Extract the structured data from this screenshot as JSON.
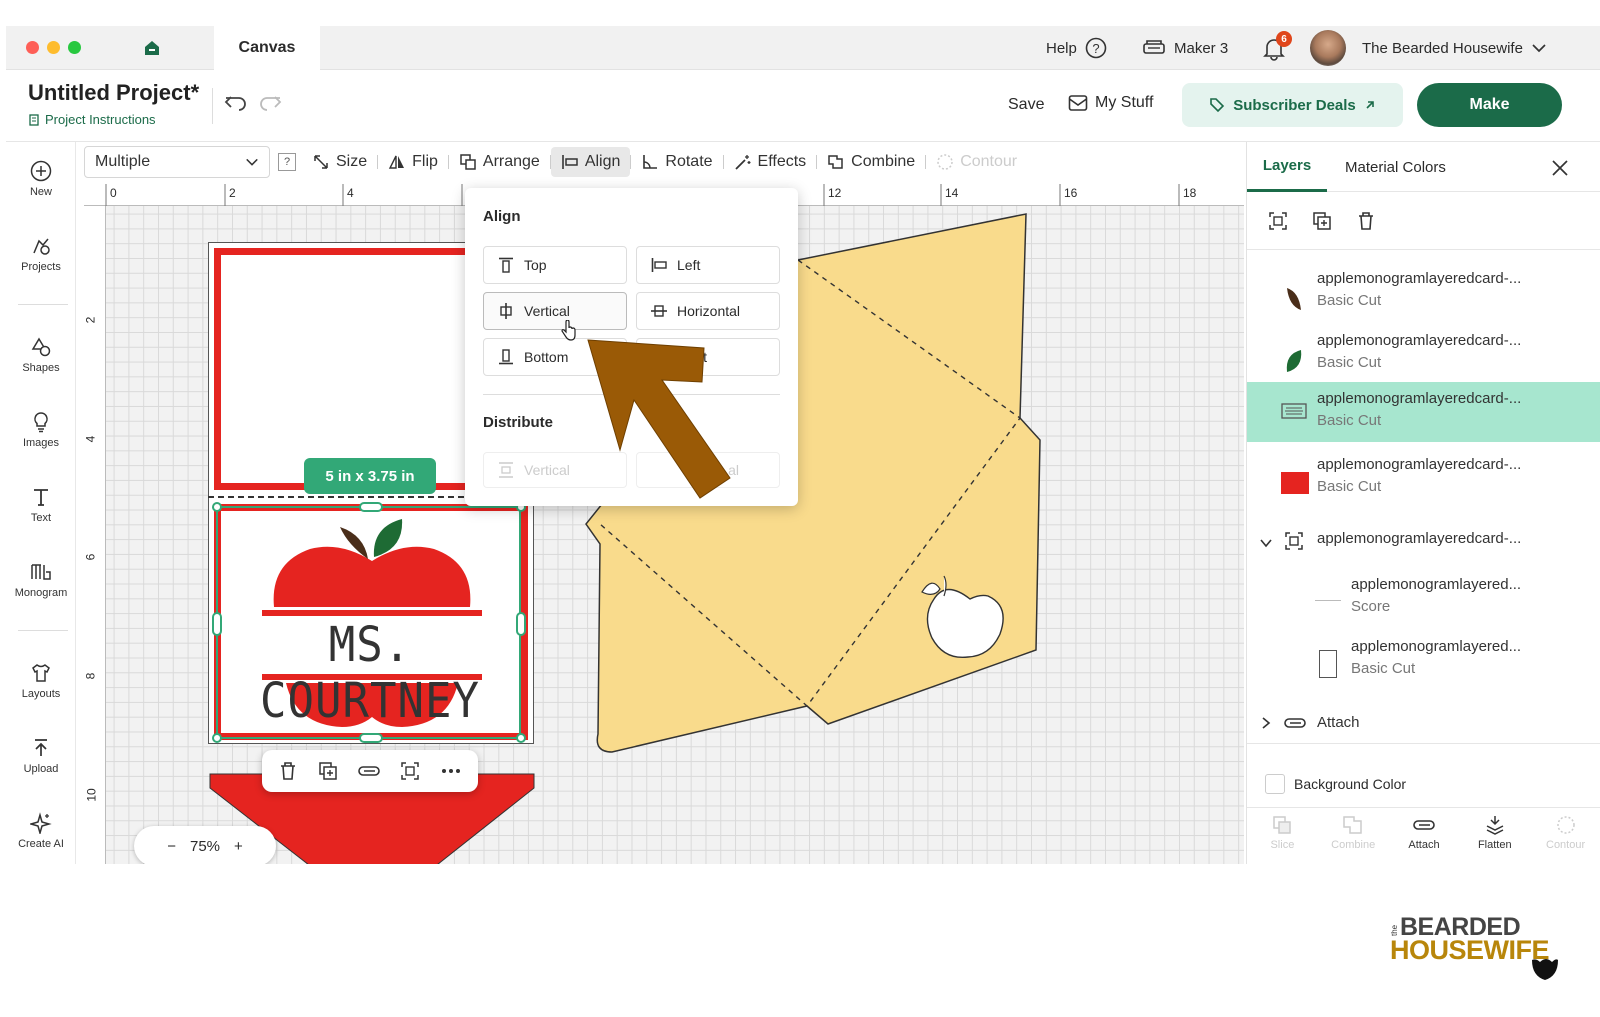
{
  "window": {
    "tab": "Canvas"
  },
  "topbar": {
    "help": "Help",
    "machine": "Maker 3",
    "notifications": "6",
    "user": "The Bearded Housewife"
  },
  "project": {
    "title": "Untitled Project*",
    "instructions": "Project Instructions",
    "save": "Save",
    "my_stuff": "My Stuff",
    "subscriber_deals": "Subscriber Deals",
    "make": "Make"
  },
  "toolbar": {
    "select": "Multiple",
    "help": "?",
    "size": "Size",
    "flip": "Flip",
    "arrange": "Arrange",
    "align": "Align",
    "rotate": "Rotate",
    "effects": "Effects",
    "combine": "Combine",
    "contour": "Contour"
  },
  "leftnav": [
    "New",
    "Projects",
    "Shapes",
    "Images",
    "Text",
    "Monogram",
    "Layouts",
    "Upload",
    "Create AI"
  ],
  "ruler": {
    "top": [
      "0",
      "2",
      "4",
      "12",
      "14",
      "16",
      "18"
    ],
    "left": [
      "2",
      "4",
      "6",
      "8",
      "10"
    ]
  },
  "align_menu": {
    "title": "Align",
    "top": "Top",
    "left": "Left",
    "vertical": "Vertical",
    "horizontal": "Horizontal",
    "bottom": "Bottom",
    "right_partial": "t",
    "distribute_title": "Distribute",
    "dist_vertical": "Vertical",
    "dist_horizontal": "al"
  },
  "canvas": {
    "size_badge": "5 in x 3.75 in",
    "card_text": "MS. COURTNEY",
    "zoom": "75%",
    "zoom_minus": "−",
    "zoom_plus": "+"
  },
  "panel": {
    "tab_layers": "Layers",
    "tab_material": "Material Colors",
    "layers": [
      {
        "name": "applemonogramlayeredcard-...",
        "sub": "Basic Cut"
      },
      {
        "name": "applemonogramlayeredcard-...",
        "sub": "Basic Cut"
      },
      {
        "name": "applemonogramlayeredcard-...",
        "sub": "Basic Cut"
      },
      {
        "name": "applemonogramlayeredcard-...",
        "sub": "Basic Cut"
      },
      {
        "name": "applemonogramlayeredcard-..."
      },
      {
        "name": "applemonogramlayered...",
        "sub": "Score"
      },
      {
        "name": "applemonogramlayered...",
        "sub": "Basic Cut"
      }
    ],
    "attach": "Attach",
    "background_color": "Background Color",
    "bottom": [
      "Slice",
      "Combine",
      "Attach",
      "Flatten",
      "Contour"
    ]
  },
  "watermark": {
    "the": "the",
    "line1": "BEARDED",
    "line2": "HOUSEWIFE"
  },
  "colors": {
    "brand_green": "#1b6b49",
    "deals_bg": "#e4f3ee",
    "selected_row": "#a7e6cf",
    "card_red": "#e52420",
    "envelope": "#f9db8c",
    "arrow": "#9a5a06"
  }
}
